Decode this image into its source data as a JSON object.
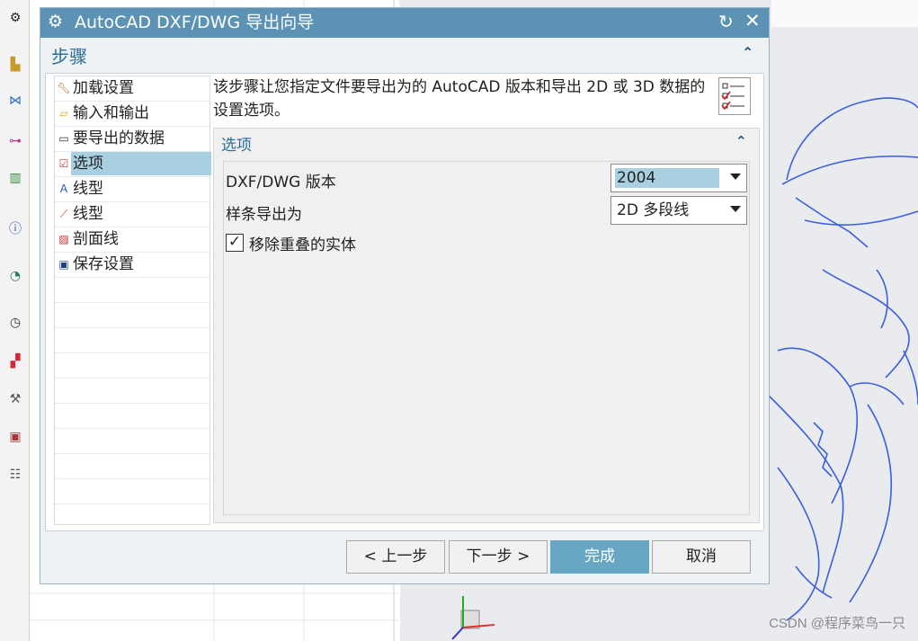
{
  "dialog": {
    "title": "AutoCAD DXF/DWG 导出向导",
    "steps_heading": "步骤",
    "description": "该步骤让您指定文件要导出为的 AutoCAD 版本和导出 2D 或 3D 数据的设置选项。"
  },
  "steps": [
    {
      "label": "加载设置",
      "icon": "wrench-icon"
    },
    {
      "label": "输入和输出",
      "icon": "folder-open-icon"
    },
    {
      "label": "要导出的数据",
      "icon": "window-icon"
    },
    {
      "label": "选项",
      "icon": "options-checklist-icon",
      "selected": true
    },
    {
      "label": "线型",
      "icon": "linetype-icon"
    },
    {
      "label": "线型",
      "icon": "line-icon"
    },
    {
      "label": "剖面线",
      "icon": "hatch-icon"
    },
    {
      "label": "保存设置",
      "icon": "save-icon"
    }
  ],
  "options": {
    "heading": "选项",
    "version_label": "DXF/DWG 版本",
    "version_value": "2004",
    "spline_label": "样条导出为",
    "spline_value": "2D 多段线",
    "remove_overlap_label": "移除重叠的实体",
    "remove_overlap_checked": true
  },
  "buttons": {
    "back": "< 上一步",
    "next": "下一步 >",
    "finish": "完成",
    "cancel": "取消"
  },
  "watermark": "CSDN @程序菜鸟一只",
  "colors": {
    "titlebar": "#5c93b5",
    "selection": "#a8d0e1",
    "finish_button": "#67a7c4",
    "sketch_lines": "#3b5fe0"
  }
}
